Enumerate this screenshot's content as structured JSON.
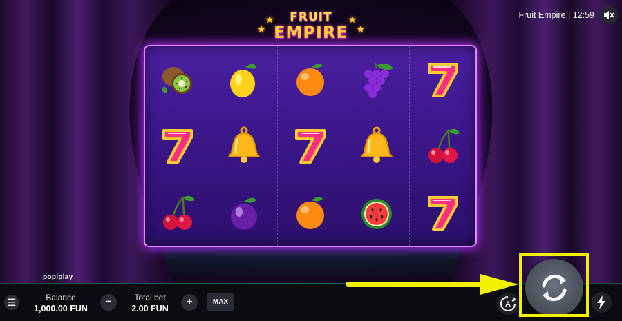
{
  "game": {
    "logo_line1": "FRUIT",
    "logo_line2": "EMPIRE",
    "provider": "popiplay"
  },
  "header": {
    "title": "Fruit Empire",
    "time": "12:59",
    "title_text": "Fruit Empire | 12:59",
    "mute_icon": "speaker-muted-icon"
  },
  "reels": [
    [
      "kiwi",
      "lemon",
      "orange",
      "grapes",
      "seven"
    ],
    [
      "seven",
      "bell",
      "seven",
      "bell",
      "cherries"
    ],
    [
      "cherries",
      "plum",
      "orange",
      "watermelon",
      "seven"
    ]
  ],
  "bottom_bar": {
    "balance_label": "Balance",
    "balance_value": "1,000.00 FUN",
    "bet_label": "Total bet",
    "bet_value": "2.00 FUN",
    "minus_label": "−",
    "plus_label": "+",
    "max_label": "MAX"
  },
  "annotation": {
    "color": "#f2f000",
    "target": "spin-button"
  }
}
